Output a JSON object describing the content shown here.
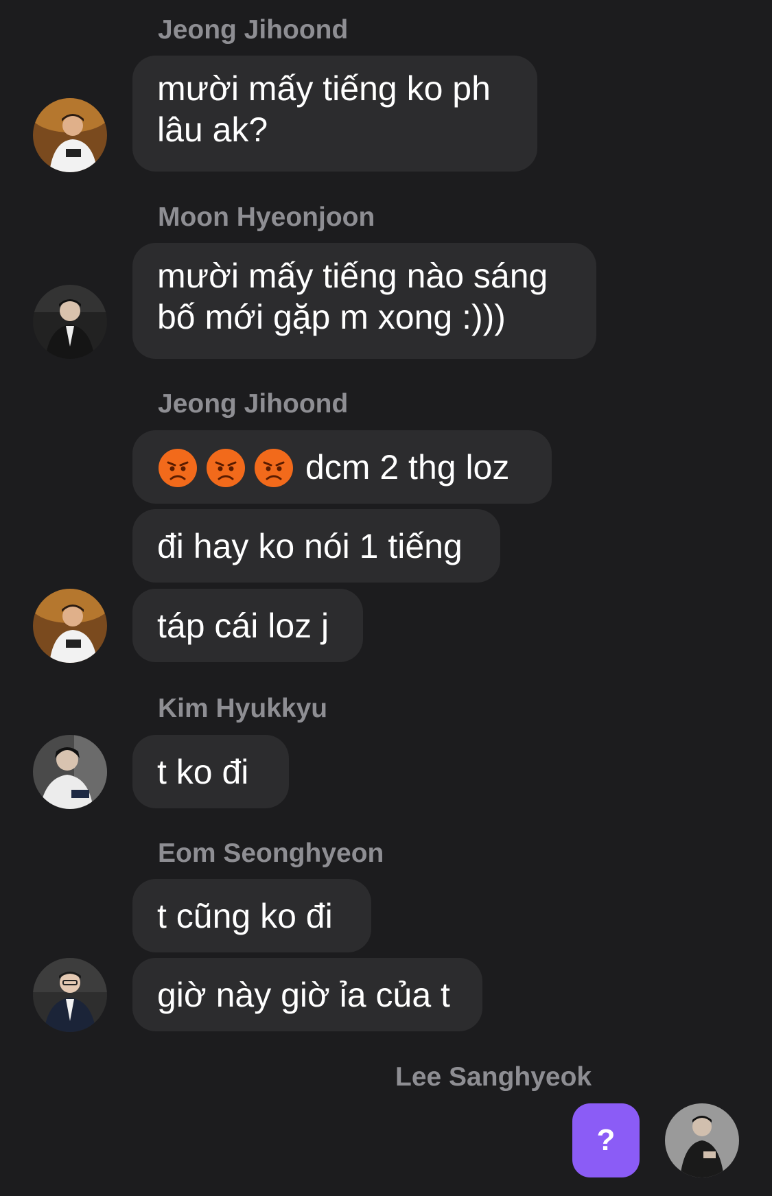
{
  "messages": [
    {
      "sender": "Jeong Jihoond",
      "bubbles": [
        "mười mấy tiếng ko ph\nlâu ak?"
      ]
    },
    {
      "sender": "Moon Hyeonjoon",
      "bubbles": [
        "mười mấy tiếng nào sáng\nbố mới gặp m xong :)))"
      ]
    },
    {
      "sender": "Jeong Jihoond",
      "bubbles": [
        "dcm 2 thg loz",
        "đi hay ko nói 1 tiếng",
        "táp cái loz j"
      ],
      "emoji": [
        "angry-face",
        "angry-face",
        "angry-face"
      ]
    },
    {
      "sender": "Kim Hyukkyu",
      "bubbles": [
        "t ko đi"
      ]
    },
    {
      "sender": "Eom Seonghyeon",
      "bubbles": [
        "t cũng ko đi",
        "giờ này giờ ỉa của t"
      ]
    },
    {
      "sender": "Lee Sanghyeok",
      "bubbles": [
        "?"
      ]
    }
  ],
  "colors": {
    "background": "#1c1c1e",
    "bubble": "#2c2c2e",
    "sender_name": "#8e8e93",
    "own_bubble": "#8b5cf6"
  }
}
